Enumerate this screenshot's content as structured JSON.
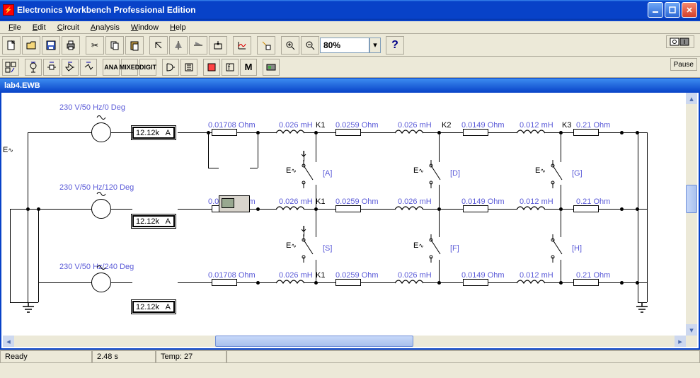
{
  "title": "Electronics Workbench Professional Edition",
  "menu": {
    "file": "File",
    "edit": "Edit",
    "circuit": "Circuit",
    "analysis": "Analysis",
    "window": "Window",
    "help": "Help"
  },
  "toolbar": {
    "zoom": "80%",
    "pause": "Pause",
    "help": "?"
  },
  "toolbar2_labels": {
    "ana": "ANA",
    "mixed": "MIXED",
    "digit": "DIGIT",
    "m": "M"
  },
  "document": {
    "title": "lab4.EWB"
  },
  "status": {
    "ready": "Ready",
    "time": "2.48 s",
    "temp": "Temp: 27"
  },
  "schematic": {
    "sources": [
      {
        "label": "230 V/50 Hz/0 Deg"
      },
      {
        "label": "230 V/50 Hz/120 Deg"
      },
      {
        "label": "230 V/50 Hz/240 Deg"
      }
    ],
    "ammeter": {
      "value": "12.12k",
      "unit": "A"
    },
    "row_labels": {
      "r": "0.01708  Ohm",
      "l": "0.026 mH",
      "r2": "0.0259  Ohm",
      "l2": "0.026 mH",
      "r3": "0.0149  Ohm",
      "l3": "0.012 mH",
      "r4": "0.21  Ohm"
    },
    "k": {
      "k1": "K1",
      "k2": "K2",
      "k3": "K3"
    },
    "emf": "E",
    "keys": {
      "a": "[A]",
      "d": "[D]",
      "g": "[G]",
      "s": "[S]",
      "f": "[F]",
      "h": "[H]"
    }
  }
}
